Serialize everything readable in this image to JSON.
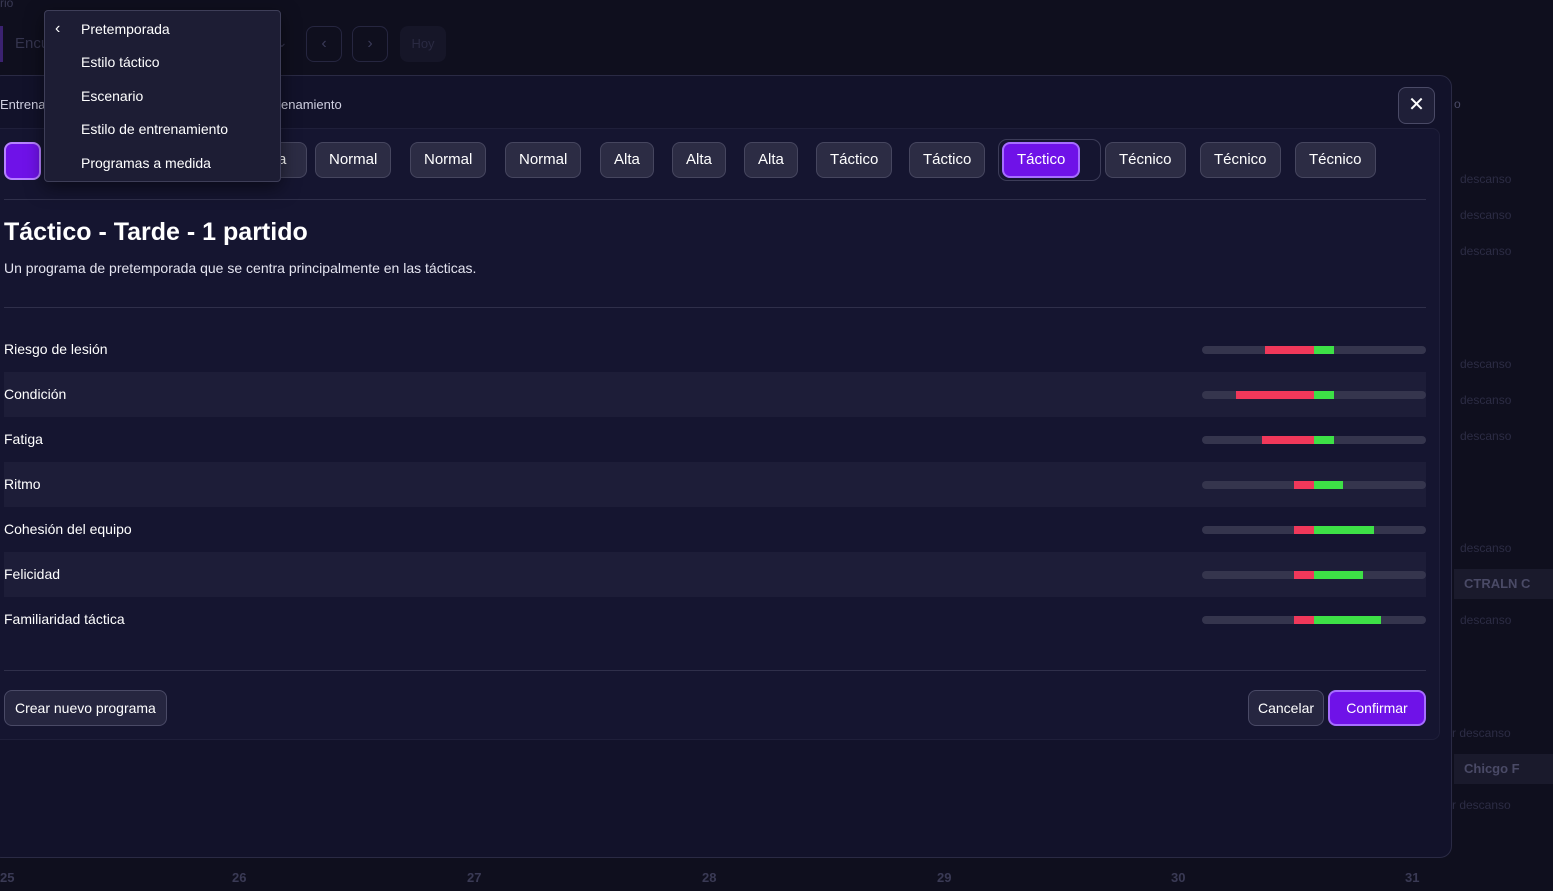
{
  "background": {
    "top_label": "rio",
    "search_placeholder": "Encu",
    "nav_prev": "‹",
    "nav_next": "›",
    "today_label": "Hoy",
    "side_items": [
      "descanso",
      "descanso",
      "descanso",
      "descanso",
      "descanso",
      "descanso",
      "descanso",
      "descanso",
      "r descanso",
      "r descanso"
    ],
    "pills": [
      "CTRALN C",
      "Chicgo F"
    ],
    "days": [
      "25",
      "26",
      "27",
      "28",
      "29",
      "30",
      "31"
    ]
  },
  "modal": {
    "tab_left": "Entrenar",
    "tab_right": "enamiento",
    "tab_far_right": "o",
    "close_icon": "close-icon",
    "chips": [
      {
        "label": "a"
      },
      {
        "label": "Normal"
      },
      {
        "label": "Normal"
      },
      {
        "label": "Normal"
      },
      {
        "label": "Alta"
      },
      {
        "label": "Alta"
      },
      {
        "label": "Alta"
      },
      {
        "label": "Táctico"
      },
      {
        "label": "Táctico"
      },
      {
        "label": "Táctico",
        "selected": true
      },
      {
        "label": "Técnico"
      },
      {
        "label": "Técnico"
      },
      {
        "label": "Técnico"
      }
    ],
    "program": {
      "title": "Táctico - Tarde - 1 partido",
      "description": "Un programa de pretemporada que se centra principalmente en las tácticas."
    },
    "stats": [
      {
        "label": "Riesgo de lesión",
        "neg": 0.22,
        "pos": 0.09
      },
      {
        "label": "Condición",
        "neg": 0.35,
        "pos": 0.09
      },
      {
        "label": "Fatiga",
        "neg": 0.23,
        "pos": 0.09
      },
      {
        "label": "Ritmo",
        "neg": 0.09,
        "pos": 0.13
      },
      {
        "label": "Cohesión del equipo",
        "neg": 0.09,
        "pos": 0.27
      },
      {
        "label": "Felicidad",
        "neg": 0.09,
        "pos": 0.22
      },
      {
        "label": "Familiaridad táctica",
        "neg": 0.09,
        "pos": 0.3
      }
    ],
    "buttons": {
      "create": "Crear nuevo programa",
      "cancel": "Cancelar",
      "confirm": "Confirmar"
    }
  },
  "dropdown": {
    "back_icon": "chevron-left-icon",
    "header": "Pretemporada",
    "items": [
      "Estilo táctico",
      "Escenario",
      "Estilo de entrenamiento",
      "Programas a medida"
    ]
  },
  "colors": {
    "accent": "#6f12e8",
    "negative": "#f0385a",
    "positive": "#3de046"
  }
}
